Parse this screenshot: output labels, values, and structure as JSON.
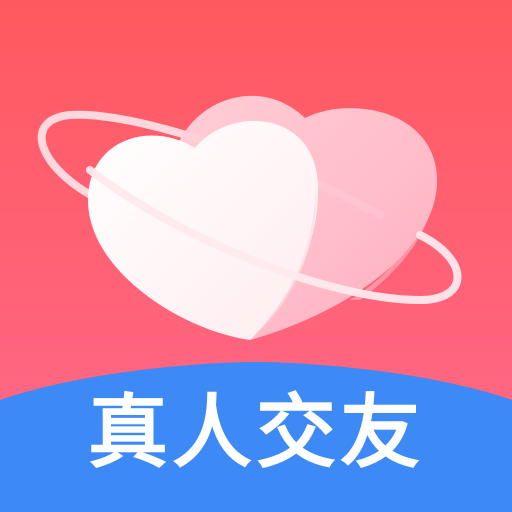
{
  "app_icon": {
    "label": "真人交友",
    "colors": {
      "background_top": "#FF5A5F",
      "background_bottom": "#FF6B8C",
      "banner": "#3D8AF7",
      "heart_front": "#FFF6F7",
      "heart_back": "#FFC0CB",
      "ring": "#FFE7EB"
    },
    "icon_names": [
      "heart-icon",
      "planet-ring-icon"
    ]
  }
}
